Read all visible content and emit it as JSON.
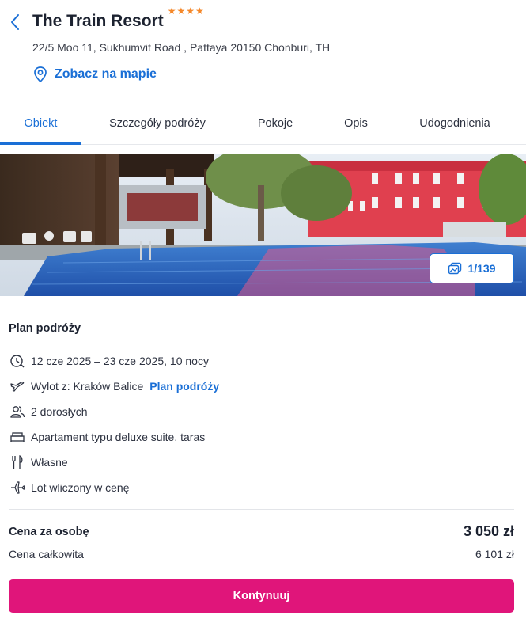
{
  "header": {
    "back_icon": "chevron-left-icon",
    "title": "The Train Resort",
    "stars": 4,
    "address": "22/5 Moo 11, Sukhumvit Road , Pattaya 20150 Chonburi, TH",
    "map_link": "Zobacz na mapie",
    "map_icon": "map-pin-icon"
  },
  "tabs": [
    {
      "label": "Obiekt",
      "active": true
    },
    {
      "label": "Szczegóły podróży",
      "active": false
    },
    {
      "label": "Pokoje",
      "active": false
    },
    {
      "label": "Opis",
      "active": false
    },
    {
      "label": "Udogodnienia",
      "active": false
    }
  ],
  "gallery": {
    "counter": "1/139",
    "icon": "gallery-icon"
  },
  "plan": {
    "title": "Plan podróży",
    "items": [
      {
        "icon": "calendar-icon",
        "text": "12 cze 2025 – 23 cze 2025, 10 nocy"
      },
      {
        "icon": "plane-departure-icon",
        "text": "Wylot z: Kraków Balice",
        "link": "Plan podróży"
      },
      {
        "icon": "people-icon",
        "text": "2 dorosłych"
      },
      {
        "icon": "bed-icon",
        "text": "Apartament typu deluxe suite, taras"
      },
      {
        "icon": "cutlery-icon",
        "text": "Własne"
      },
      {
        "icon": "plane-icon",
        "text": "Lot wliczony w cenę"
      }
    ]
  },
  "price": {
    "per_person_label": "Cena za osobę",
    "per_person_value": "3 050 zł",
    "total_label": "Cena całkowita",
    "total_value": "6 101 zł"
  },
  "cta": {
    "label": "Kontynuuj"
  },
  "colors": {
    "accent": "#1a6fd6",
    "cta": "#e0157a",
    "stars": "#f5882a"
  }
}
